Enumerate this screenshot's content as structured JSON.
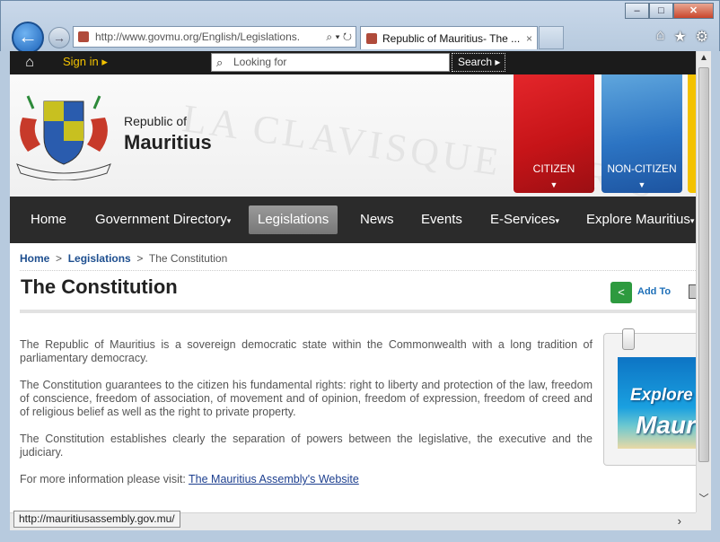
{
  "browser": {
    "address_url": "http://www.govmu.org/English/Legislations.",
    "tab_title": "Republic of Mauritius- The ...",
    "window_min": "‒",
    "window_max": "□",
    "window_close": "✕",
    "status_url": "http://mauritiusassembly.gov.mu/"
  },
  "topbar": {
    "signin_label": "Sign in",
    "search_placeholder": "Looking for",
    "search_button": "Search"
  },
  "header": {
    "republic_of": "Republic of",
    "country": "Mauritius",
    "watermark": "LA CLAVISQUE MARIS",
    "tiles": [
      {
        "label": "CITIZEN",
        "color": "#c61418"
      },
      {
        "label": "NON-CITIZEN",
        "color": "#2c74c3"
      }
    ]
  },
  "nav": {
    "items": [
      {
        "label": "Home"
      },
      {
        "label": "Government Directory"
      },
      {
        "label": "Legislations"
      },
      {
        "label": "News"
      },
      {
        "label": "Events"
      },
      {
        "label": "E-Services"
      },
      {
        "label": "Explore Mauritius"
      }
    ],
    "active_index": 2
  },
  "breadcrumb": {
    "home": "Home",
    "legislations": "Legislations",
    "current": "The Constitution"
  },
  "page": {
    "title": "The Constitution",
    "add_to": "Add To",
    "paragraphs": [
      "The Republic of Mauritius is a sovereign democratic state within the Commonwealth with a long tradition of parliamentary democracy.",
      "The Constitution guarantees to the citizen his fundamental rights: right to liberty and protection of the law, freedom of conscience, freedom of association, of movement and of opinion, freedom of expression, freedom of creed and of religious belief as well as the right to private property.",
      "The Constitution establishes clearly the separation of powers between the legislative, the executive and the judiciary."
    ],
    "more_info_prefix": "For more information please visit:",
    "more_info_link": "The Mauritius Assembly's Website"
  },
  "promo": {
    "line1": "Explore",
    "line2": "Maur"
  }
}
